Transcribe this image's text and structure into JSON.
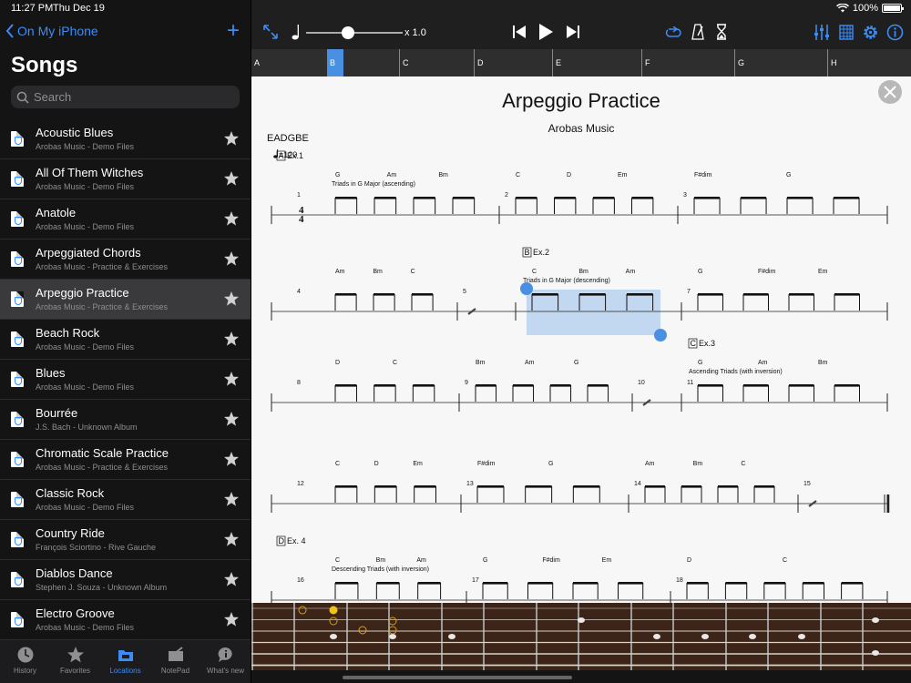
{
  "status": {
    "time": "11:27 PM",
    "date": "Thu Dec 19",
    "battery": "100%"
  },
  "sidebar": {
    "back_label": "On My iPhone",
    "title": "Songs",
    "search_placeholder": "Search",
    "songs": [
      {
        "name": "Acoustic Blues",
        "sub": "Arobas Music - Demo Files"
      },
      {
        "name": "All Of Them Witches",
        "sub": "Arobas Music - Demo Files"
      },
      {
        "name": "Anatole",
        "sub": "Arobas Music - Demo Files"
      },
      {
        "name": "Arpeggiated Chords",
        "sub": "Arobas Music - Practice & Exercises"
      },
      {
        "name": "Arpeggio Practice",
        "sub": "Arobas Music - Practice & Exercises"
      },
      {
        "name": "Beach Rock",
        "sub": "Arobas Music - Demo Files"
      },
      {
        "name": "Blues",
        "sub": "Arobas Music - Demo Files"
      },
      {
        "name": "Bourrée",
        "sub": "J.S. Bach - Unknown Album"
      },
      {
        "name": "Chromatic Scale Practice",
        "sub": "Arobas Music - Practice & Exercises"
      },
      {
        "name": "Classic Rock",
        "sub": "Arobas Music - Demo Files"
      },
      {
        "name": "Country Ride",
        "sub": "François Sciortino - Rive Gauche"
      },
      {
        "name": "Diablos Dance",
        "sub": "Stephen J. Souza - Unknown Album"
      },
      {
        "name": "Electro Groove",
        "sub": "Arobas Music - Demo Files"
      }
    ],
    "selected_index": 4
  },
  "tabs": [
    {
      "label": "History",
      "icon": "clock-icon"
    },
    {
      "label": "Favorites",
      "icon": "star-icon"
    },
    {
      "label": "Locations",
      "icon": "folder-icon"
    },
    {
      "label": "NotePad",
      "icon": "notepad-icon"
    },
    {
      "label": "What's new",
      "icon": "info-bubble-icon"
    }
  ],
  "active_tab": 2,
  "toolbar": {
    "speed": "x 1.0",
    "speed_level": 0.43
  },
  "sections": [
    "A",
    "B",
    "C",
    "D",
    "E",
    "F",
    "G",
    "H"
  ],
  "active_section": 1,
  "score": {
    "title": "Arpeggio Practice",
    "artist": "Arobas Music",
    "tuning": "EADGBE",
    "tempo": "=120",
    "systems": [
      {
        "measures": [
          {
            "num": "1",
            "chords": [
              "G",
              "Am",
              "Bm"
            ],
            "marker": "A",
            "marker_text": "Ex.1",
            "annotation": "Triads in G Major (ascending)"
          },
          {
            "num": "2",
            "chords": [
              "C",
              "D",
              "Em"
            ]
          },
          {
            "num": "3",
            "chords": [
              "F#dim",
              "G"
            ]
          }
        ]
      },
      {
        "measures": [
          {
            "num": "4",
            "chords": [
              "Am",
              "Bm",
              "C"
            ]
          },
          {
            "num": "5",
            "chords": []
          },
          {
            "num": "6",
            "chords": [
              "C",
              "Bm",
              "Am"
            ],
            "marker": "B",
            "marker_text": "Ex.2",
            "annotation": "Triads in G Major (descending)"
          },
          {
            "num": "7",
            "chords": [
              "G",
              "F#dim",
              "Em"
            ]
          }
        ]
      },
      {
        "measures": [
          {
            "num": "8",
            "chords": [
              "D",
              "C"
            ]
          },
          {
            "num": "9",
            "chords": [
              "Bm",
              "Am",
              "G"
            ]
          },
          {
            "num": "10",
            "chords": []
          },
          {
            "num": "11",
            "chords": [
              "G",
              "Am",
              "Bm"
            ],
            "marker": "C",
            "marker_text": "Ex.3",
            "annotation": "Ascending Triads (with inversion)"
          }
        ]
      },
      {
        "measures": [
          {
            "num": "12",
            "chords": [
              "C",
              "D",
              "Em"
            ]
          },
          {
            "num": "13",
            "chords": [
              "F#dim",
              "G"
            ]
          },
          {
            "num": "14",
            "chords": [
              "Am",
              "Bm",
              "C"
            ]
          },
          {
            "num": "15",
            "chords": []
          }
        ]
      },
      {
        "measures": [
          {
            "num": "16",
            "chords": [
              "C",
              "Bm",
              "Am"
            ],
            "marker": "D",
            "marker_text": "Ex. 4",
            "annotation": "Descending Triads (with inversion)"
          },
          {
            "num": "17",
            "chords": [
              "G",
              "F#dim",
              "Em"
            ]
          },
          {
            "num": "18",
            "chords": [
              "D",
              "C"
            ]
          }
        ]
      }
    ]
  },
  "colors": {
    "accent": "#3b8cf6",
    "selection": "#4a90e2"
  }
}
